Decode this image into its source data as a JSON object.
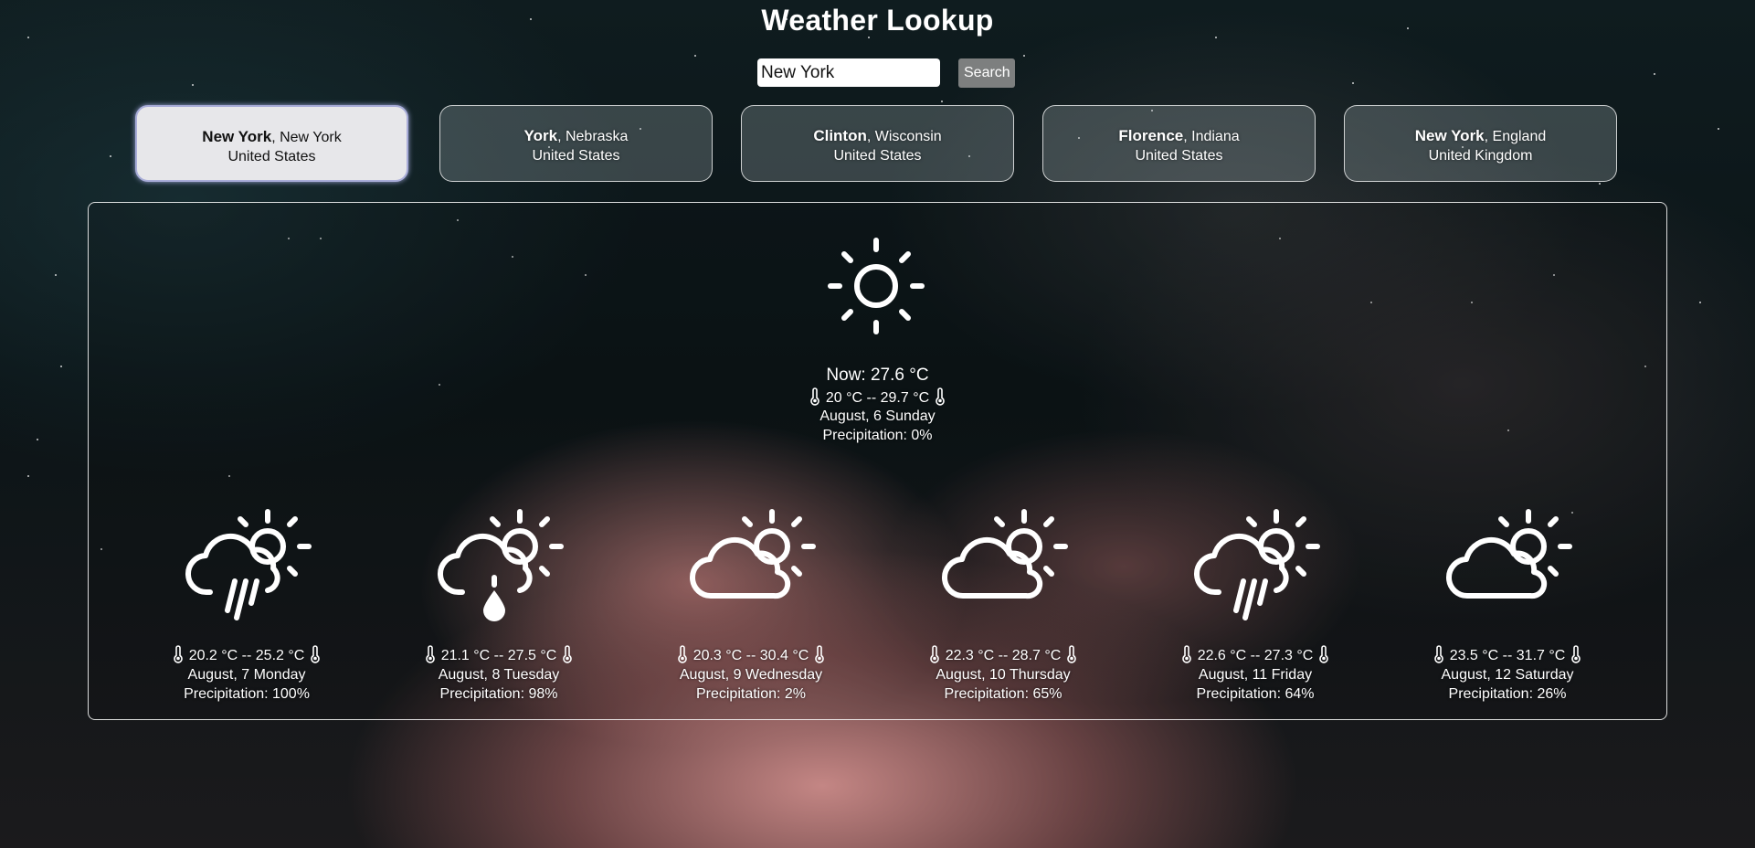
{
  "app": {
    "title": "Weather Lookup"
  },
  "search": {
    "value": "New York",
    "button_label": "Search"
  },
  "locations": [
    {
      "city": "New York",
      "region": ", New York",
      "country": "United States",
      "selected": true
    },
    {
      "city": "York",
      "region": ", Nebraska",
      "country": "United States",
      "selected": false
    },
    {
      "city": "Clinton",
      "region": ", Wisconsin",
      "country": "United States",
      "selected": false
    },
    {
      "city": "Florence",
      "region": ", Indiana",
      "country": "United States",
      "selected": false
    },
    {
      "city": "New York",
      "region": ", England",
      "country": "United Kingdom",
      "selected": false
    }
  ],
  "current": {
    "icon": "sun-icon",
    "now": "Now: 27.6 °C",
    "range": "20 °C -- 29.7 °C",
    "date": "August, 6 Sunday",
    "precipitation": "Precipitation: 0%"
  },
  "forecast": [
    {
      "icon": "partly-cloudy-rain-icon",
      "range": "20.2 °C -- 25.2 °C",
      "date": "August, 7 Monday",
      "precipitation": "Precipitation: 100%"
    },
    {
      "icon": "partly-cloudy-drizzle-icon",
      "range": "21.1 °C -- 27.5 °C",
      "date": "August, 8 Tuesday",
      "precipitation": "Precipitation: 98%"
    },
    {
      "icon": "partly-cloudy-icon",
      "range": "20.3 °C -- 30.4 °C",
      "date": "August, 9 Wednesday",
      "precipitation": "Precipitation: 2%"
    },
    {
      "icon": "partly-cloudy-icon",
      "range": "22.3 °C -- 28.7 °C",
      "date": "August, 10 Thursday",
      "precipitation": "Precipitation: 65%"
    },
    {
      "icon": "partly-cloudy-rain-icon",
      "range": "22.6 °C -- 27.3 °C",
      "date": "August, 11 Friday",
      "precipitation": "Precipitation: 64%"
    },
    {
      "icon": "partly-cloudy-icon",
      "range": "23.5 °C -- 31.7 °C",
      "date": "August, 12 Saturday",
      "precipitation": "Precipitation: 26%"
    }
  ]
}
